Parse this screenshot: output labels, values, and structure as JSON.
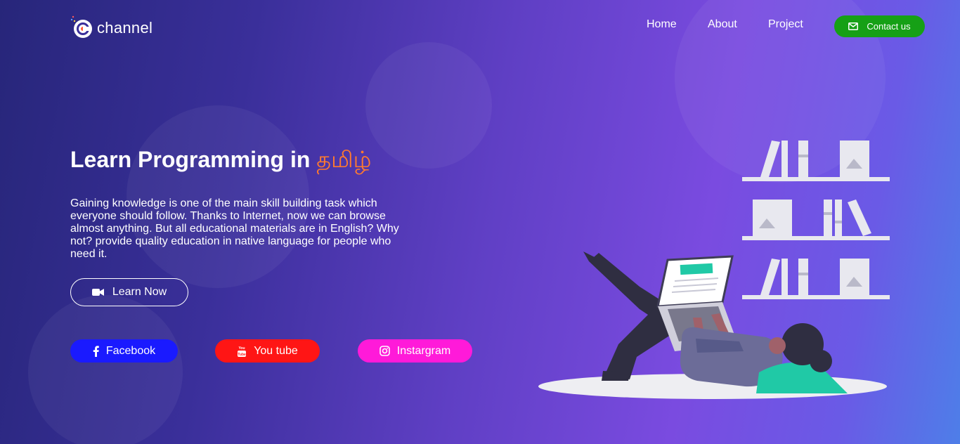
{
  "brand": {
    "name": "channel",
    "logo_icon": "c-logo-icon"
  },
  "nav": {
    "links": [
      "Home",
      "About",
      "Project"
    ],
    "contact_label": "Contact us",
    "contact_icon": "envelope-icon",
    "contact_color": "#16a016"
  },
  "hero": {
    "title": "Learn Programming in ",
    "title_accent": "தமிழ்",
    "accent_color": "#ff7a2e",
    "description": "Gaining knowledge is one of the main skill building task which everyone should follow. Thanks to Internet, now we can browse almost anything. But all educational materials are in English? Why not? provide quality education in native language for people who need it.",
    "cta_label": "Learn Now",
    "cta_icon": "video-camera-icon"
  },
  "social": [
    {
      "label": "Facebook",
      "icon": "facebook-icon",
      "color": "#1a1aff"
    },
    {
      "label": "You tube",
      "icon": "youtube-icon",
      "color": "#ff1515"
    },
    {
      "label": "Instargram",
      "icon": "instagram-icon",
      "color": "#ff1ad9"
    }
  ]
}
